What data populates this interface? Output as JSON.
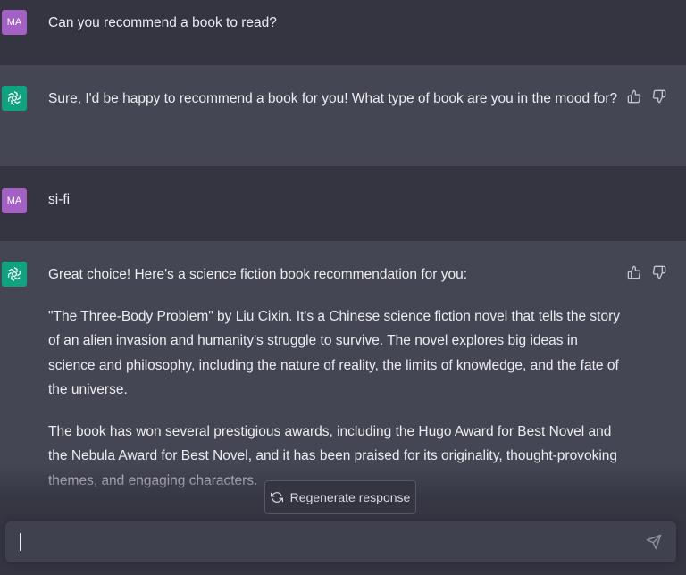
{
  "messages": [
    {
      "role": "user",
      "avatar": "MA",
      "paragraphs": [
        "Can you recommend a book to read?"
      ]
    },
    {
      "role": "assistant",
      "paragraphs": [
        "Sure, I'd be happy to recommend a book for you! What type of book are you in the mood for?"
      ]
    },
    {
      "role": "user",
      "avatar": "MA",
      "paragraphs": [
        "si-fi"
      ]
    },
    {
      "role": "assistant",
      "paragraphs": [
        "Great choice! Here's a science fiction book recommendation for you:",
        "\"The Three-Body Problem\" by Liu Cixin. It's a Chinese science fiction novel that tells the story of an alien invasion and humanity's struggle to survive. The novel explores big ideas in science and philosophy, including the nature of reality, the limits of knowledge, and the fate of the universe.",
        "The book has won several prestigious awards, including the Hugo Award for Best Novel and the Nebula Award for Best Novel, and it has been praised for its originality, thought-provoking themes, and engaging characters."
      ]
    }
  ],
  "regenerate_label": "Regenerate response",
  "input": {
    "value": ""
  },
  "icons": {
    "thumbs_up": "thumbs-up-icon",
    "thumbs_down": "thumbs-down-icon",
    "regenerate": "refresh-icon",
    "send": "send-icon",
    "assistant_logo": "openai-logo-icon"
  },
  "colors": {
    "background": "#343541",
    "assistant_row": "#444654",
    "user_avatar": "#a461c4",
    "assistant_avatar": "#10a37f",
    "input_bg": "#40414f"
  }
}
